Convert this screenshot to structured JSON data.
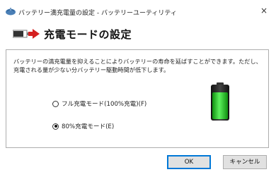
{
  "window": {
    "title": "バッテリー満充電量の設定 - バッテリーユーティリティ",
    "close_glyph": "×"
  },
  "header": {
    "title": "充電モードの設定"
  },
  "panel": {
    "description": "バッテリーの満充電量を抑えることによりバッテリーの寿命を延ばすことができます。ただし、充電される量が少ない分バッテリー駆動時間が低下します。",
    "options": [
      {
        "label": "フル充電モード(100%充電)(F)",
        "selected": false
      },
      {
        "label": "80%充電モード(E)",
        "selected": true
      }
    ]
  },
  "footer": {
    "ok_label": "OK",
    "cancel_label": "キャンセル"
  },
  "colors": {
    "battery_green": "#22c022",
    "arrow_red": "#d42020",
    "ok_border": "#0078d7"
  }
}
